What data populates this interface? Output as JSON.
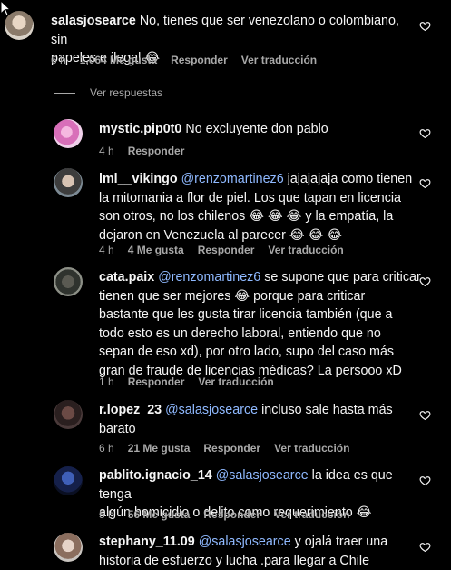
{
  "comments": [
    {
      "username": "salasjosearce",
      "text_lines": [
        "No, tienes que ser venezolano o colombiano, sin",
        "papeles e ilegal 😂"
      ],
      "time": "6 h",
      "likes": "1,064 Me gusta",
      "reply": "Responder",
      "translate": "Ver traducción"
    },
    {
      "username": "mystic.pip0t0",
      "text_lines": [
        "No excluyente don pablo"
      ],
      "time": "4 h",
      "reply": "Responder"
    },
    {
      "username": "lml__vikingo",
      "mention": "@renzomartinez6",
      "text_lines": [
        "jajajajaja como tienen",
        "la mitomania a flor de piel. Los que tapan en licencia",
        "son otros, no los chilenos 😂 😂 😂 y la empatía, la",
        "dejaron en Venezuela al parecer 😂 😂 😂"
      ],
      "time": "4 h",
      "likes": "4 Me gusta",
      "reply": "Responder",
      "translate": "Ver traducción"
    },
    {
      "username": "cata.paix",
      "mention": "@renzomartinez6",
      "text_lines": [
        "se supone que para criticar",
        "tienen que ser mejores 😂 porque para criticar",
        "bastante que les gusta tirar licencia también (que a",
        "todo esto es un derecho laboral, entiendo que no",
        "sepan de eso xd), por otro lado, supo del caso más",
        "gran de fraude de licencias médicas? La persooo xD"
      ],
      "time": "1 h",
      "reply": "Responder",
      "translate": "Ver traducción"
    },
    {
      "username": "r.lopez_23",
      "mention": "@salasjosearce",
      "text_lines": [
        "incluso sale hasta más",
        "barato"
      ],
      "time": "6 h",
      "likes": "21 Me gusta",
      "reply": "Responder",
      "translate": "Ver traducción"
    },
    {
      "username": "pablito.ignacio_14",
      "mention": "@salasjosearce",
      "text_lines": [
        "la idea es que tenga",
        "algún homicidio o delito como requerimiento 😂"
      ],
      "time": "5 h",
      "likes": "56 Me gusta",
      "reply": "Responder",
      "translate": "Ver traducción"
    },
    {
      "username": "stephany_11.09",
      "mention": "@salasjosearce",
      "text_lines": [
        "y ojalá traer una",
        "historia de esfuerzo y lucha .para llegar a Chile"
      ]
    }
  ],
  "view_replies": "Ver respuestas",
  "colors": {
    "background": "#000000",
    "text": "#f5f5f5",
    "meta": "#a8a8a8",
    "mention": "#8fb9ff"
  }
}
